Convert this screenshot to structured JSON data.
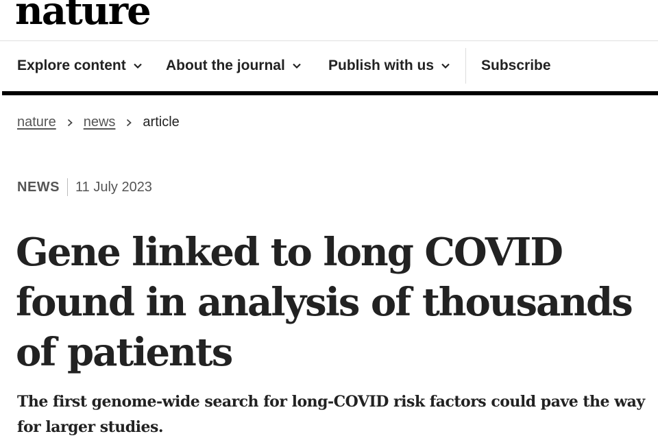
{
  "masthead": {
    "logo_text": "nature"
  },
  "nav": {
    "items": [
      {
        "label": "Explore content",
        "icon": "chevron-down-icon"
      },
      {
        "label": "About the journal",
        "icon": "chevron-down-icon"
      },
      {
        "label": "Publish with us",
        "icon": "chevron-down-icon"
      }
    ],
    "subscribe_label": "Subscribe"
  },
  "breadcrumb": {
    "items": [
      "nature",
      "news"
    ],
    "current": "article",
    "separator_icon": "chevron-right-icon"
  },
  "article": {
    "type": "NEWS",
    "date": "11 July 2023",
    "title": "Gene linked to long COVID found in analysis of thousands of patients",
    "standfirst": "The first genome-wide search for long-COVID risk factors could pave the way for larger studies."
  },
  "colors": {
    "text": "#222222",
    "muted": "#555555",
    "rule": "#000000"
  }
}
